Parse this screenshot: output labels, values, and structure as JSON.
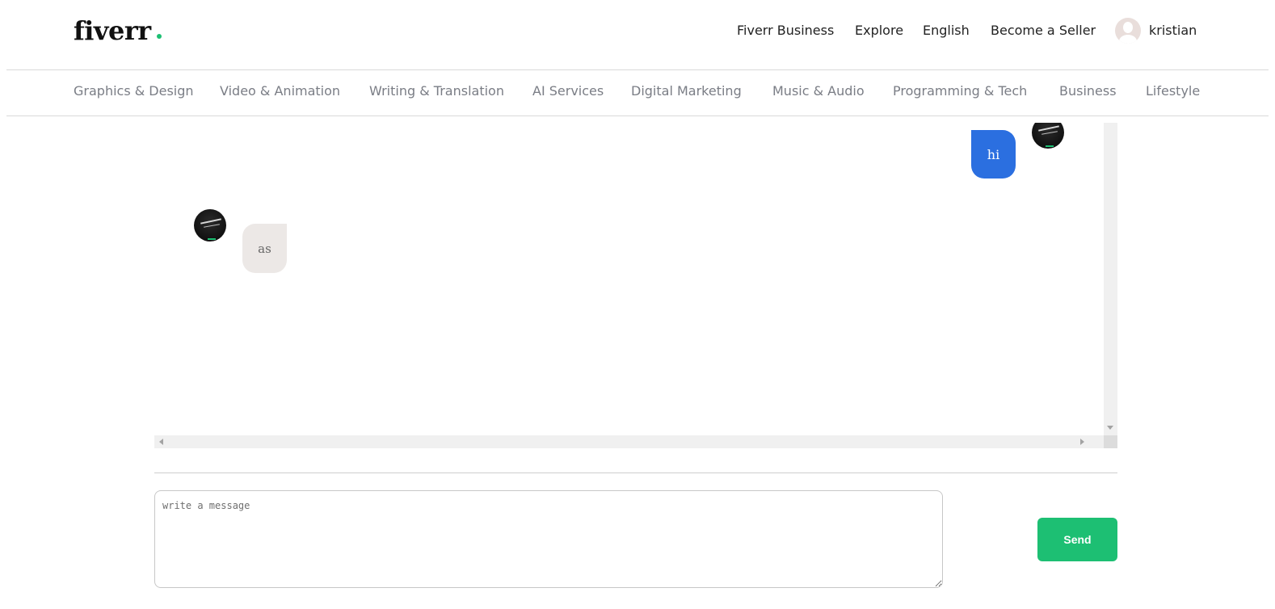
{
  "brand": {
    "logo_text": "fiverr",
    "accent_color": "#1dbf73"
  },
  "topnav": {
    "items": [
      "Fiverr Business",
      "Explore",
      "English",
      "Become a Seller"
    ],
    "username": "kristian",
    "avatar_icon": "user-placeholder-icon"
  },
  "categories": [
    "Graphics & Design",
    "Video & Animation",
    "Writing & Translation",
    "AI Services",
    "Digital Marketing",
    "Music & Audio",
    "Programming & Tech",
    "Business",
    "Lifestyle"
  ],
  "chat": {
    "messages": [
      {
        "direction": "outgoing",
        "text": "hi",
        "bubble_color": "#2b6fe0"
      },
      {
        "direction": "incoming",
        "text": "as",
        "bubble_color": "#ece8e6"
      }
    ]
  },
  "composer": {
    "placeholder": "write a message",
    "value": "",
    "send_label": "Send",
    "send_color": "#1dbf73"
  }
}
